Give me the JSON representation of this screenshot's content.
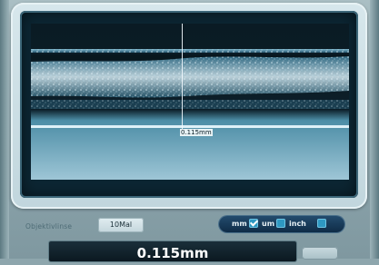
{
  "viewer": {
    "measurement_label": "0.115mm"
  },
  "controls": {
    "objective_label": "Objektivlinse",
    "objective_value": "10Mal",
    "units": [
      {
        "label": "mm",
        "checked": true
      },
      {
        "label": "um",
        "checked": false
      },
      {
        "label": "inch",
        "checked": false
      }
    ]
  },
  "readout": {
    "value": "0.115mm"
  },
  "colors": {
    "screen_bg": "#0c2633",
    "unit_pill": "#0f2c47",
    "checkbox": "#2e98c2",
    "frame": "#c1d6dd"
  }
}
